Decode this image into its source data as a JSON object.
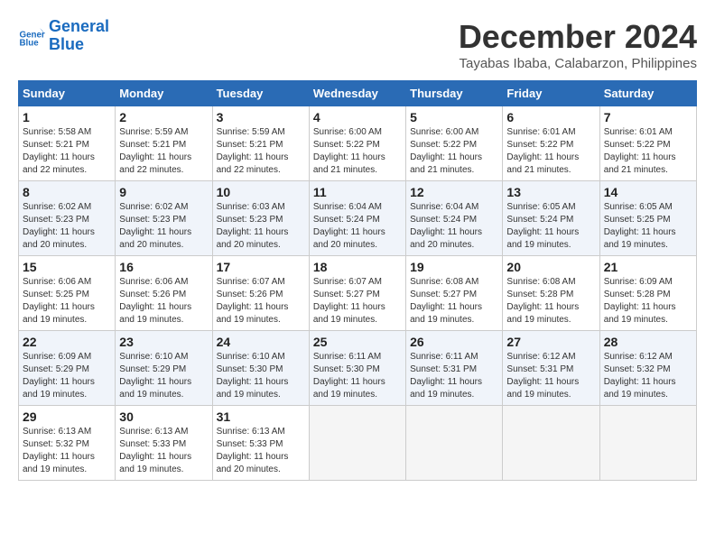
{
  "logo": {
    "line1": "General",
    "line2": "Blue"
  },
  "title": "December 2024",
  "location": "Tayabas Ibaba, Calabarzon, Philippines",
  "days_header": [
    "Sunday",
    "Monday",
    "Tuesday",
    "Wednesday",
    "Thursday",
    "Friday",
    "Saturday"
  ],
  "weeks": [
    [
      {
        "num": "1",
        "info": "Sunrise: 5:58 AM\nSunset: 5:21 PM\nDaylight: 11 hours\nand 22 minutes."
      },
      {
        "num": "2",
        "info": "Sunrise: 5:59 AM\nSunset: 5:21 PM\nDaylight: 11 hours\nand 22 minutes."
      },
      {
        "num": "3",
        "info": "Sunrise: 5:59 AM\nSunset: 5:21 PM\nDaylight: 11 hours\nand 22 minutes."
      },
      {
        "num": "4",
        "info": "Sunrise: 6:00 AM\nSunset: 5:22 PM\nDaylight: 11 hours\nand 21 minutes."
      },
      {
        "num": "5",
        "info": "Sunrise: 6:00 AM\nSunset: 5:22 PM\nDaylight: 11 hours\nand 21 minutes."
      },
      {
        "num": "6",
        "info": "Sunrise: 6:01 AM\nSunset: 5:22 PM\nDaylight: 11 hours\nand 21 minutes."
      },
      {
        "num": "7",
        "info": "Sunrise: 6:01 AM\nSunset: 5:22 PM\nDaylight: 11 hours\nand 21 minutes."
      }
    ],
    [
      {
        "num": "8",
        "info": "Sunrise: 6:02 AM\nSunset: 5:23 PM\nDaylight: 11 hours\nand 20 minutes."
      },
      {
        "num": "9",
        "info": "Sunrise: 6:02 AM\nSunset: 5:23 PM\nDaylight: 11 hours\nand 20 minutes."
      },
      {
        "num": "10",
        "info": "Sunrise: 6:03 AM\nSunset: 5:23 PM\nDaylight: 11 hours\nand 20 minutes."
      },
      {
        "num": "11",
        "info": "Sunrise: 6:04 AM\nSunset: 5:24 PM\nDaylight: 11 hours\nand 20 minutes."
      },
      {
        "num": "12",
        "info": "Sunrise: 6:04 AM\nSunset: 5:24 PM\nDaylight: 11 hours\nand 20 minutes."
      },
      {
        "num": "13",
        "info": "Sunrise: 6:05 AM\nSunset: 5:24 PM\nDaylight: 11 hours\nand 19 minutes."
      },
      {
        "num": "14",
        "info": "Sunrise: 6:05 AM\nSunset: 5:25 PM\nDaylight: 11 hours\nand 19 minutes."
      }
    ],
    [
      {
        "num": "15",
        "info": "Sunrise: 6:06 AM\nSunset: 5:25 PM\nDaylight: 11 hours\nand 19 minutes."
      },
      {
        "num": "16",
        "info": "Sunrise: 6:06 AM\nSunset: 5:26 PM\nDaylight: 11 hours\nand 19 minutes."
      },
      {
        "num": "17",
        "info": "Sunrise: 6:07 AM\nSunset: 5:26 PM\nDaylight: 11 hours\nand 19 minutes."
      },
      {
        "num": "18",
        "info": "Sunrise: 6:07 AM\nSunset: 5:27 PM\nDaylight: 11 hours\nand 19 minutes."
      },
      {
        "num": "19",
        "info": "Sunrise: 6:08 AM\nSunset: 5:27 PM\nDaylight: 11 hours\nand 19 minutes."
      },
      {
        "num": "20",
        "info": "Sunrise: 6:08 AM\nSunset: 5:28 PM\nDaylight: 11 hours\nand 19 minutes."
      },
      {
        "num": "21",
        "info": "Sunrise: 6:09 AM\nSunset: 5:28 PM\nDaylight: 11 hours\nand 19 minutes."
      }
    ],
    [
      {
        "num": "22",
        "info": "Sunrise: 6:09 AM\nSunset: 5:29 PM\nDaylight: 11 hours\nand 19 minutes."
      },
      {
        "num": "23",
        "info": "Sunrise: 6:10 AM\nSunset: 5:29 PM\nDaylight: 11 hours\nand 19 minutes."
      },
      {
        "num": "24",
        "info": "Sunrise: 6:10 AM\nSunset: 5:30 PM\nDaylight: 11 hours\nand 19 minutes."
      },
      {
        "num": "25",
        "info": "Sunrise: 6:11 AM\nSunset: 5:30 PM\nDaylight: 11 hours\nand 19 minutes."
      },
      {
        "num": "26",
        "info": "Sunrise: 6:11 AM\nSunset: 5:31 PM\nDaylight: 11 hours\nand 19 minutes."
      },
      {
        "num": "27",
        "info": "Sunrise: 6:12 AM\nSunset: 5:31 PM\nDaylight: 11 hours\nand 19 minutes."
      },
      {
        "num": "28",
        "info": "Sunrise: 6:12 AM\nSunset: 5:32 PM\nDaylight: 11 hours\nand 19 minutes."
      }
    ],
    [
      {
        "num": "29",
        "info": "Sunrise: 6:13 AM\nSunset: 5:32 PM\nDaylight: 11 hours\nand 19 minutes."
      },
      {
        "num": "30",
        "info": "Sunrise: 6:13 AM\nSunset: 5:33 PM\nDaylight: 11 hours\nand 19 minutes."
      },
      {
        "num": "31",
        "info": "Sunrise: 6:13 AM\nSunset: 5:33 PM\nDaylight: 11 hours\nand 20 minutes."
      },
      null,
      null,
      null,
      null
    ]
  ]
}
